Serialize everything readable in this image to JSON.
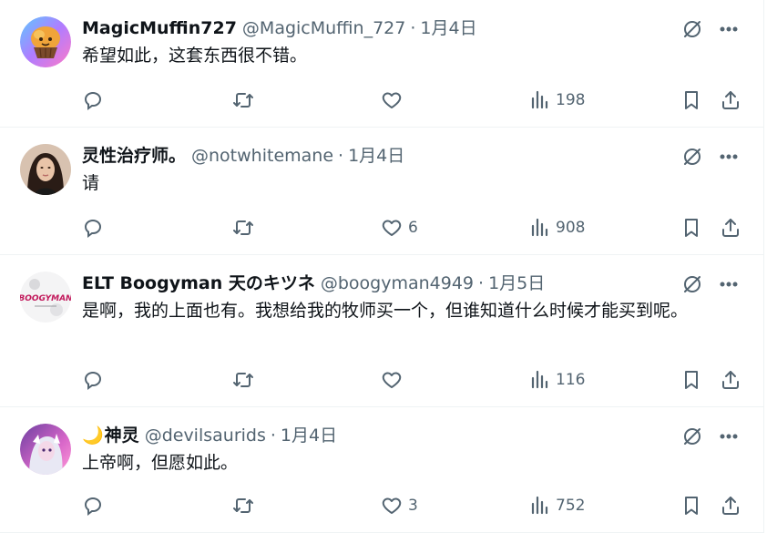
{
  "tweets": [
    {
      "name": "MagicMuffin727",
      "handle": "@MagicMuffin_727",
      "dot": "·",
      "date": "1月4日",
      "text": "希望如此，这套东西很不错。",
      "likes": "",
      "views": "198",
      "avatar": "muffin-avatar"
    },
    {
      "name": "灵性治疗师。",
      "handle": "@notwhitemane",
      "dot": "·",
      "date": "1月4日",
      "text": "请",
      "likes": "6",
      "views": "908",
      "avatar": "woman-photo-avatar"
    },
    {
      "name": "ELT Boogyman 天のキツネ",
      "handle": "@boogyman4949",
      "dot": "·",
      "date": "1月5日",
      "text": "是啊，我的上面也有。我想给我的牧师买一个，但谁知道什么时候才能买到呢。",
      "likes": "",
      "views": "116",
      "avatar": "boogyman-logo-avatar",
      "avatar_text": "BOOGYMAN"
    },
    {
      "name_emoji": "🌙",
      "name": "神灵",
      "handle": "@devilsaurids",
      "dot": "·",
      "date": "1月4日",
      "text": "上帝啊，但愿如此。",
      "likes": "3",
      "views": "752",
      "avatar": "anime-avatar"
    }
  ],
  "icons": {
    "grok": "grok-icon",
    "more": "more-icon",
    "reply": "reply-icon",
    "retweet": "retweet-icon",
    "like": "heart-icon",
    "views": "views-icon",
    "bookmark": "bookmark-icon",
    "share": "share-icon"
  },
  "colors": {
    "text": "#0f1419",
    "secondary": "#536471",
    "divider": "#eff3f4"
  }
}
